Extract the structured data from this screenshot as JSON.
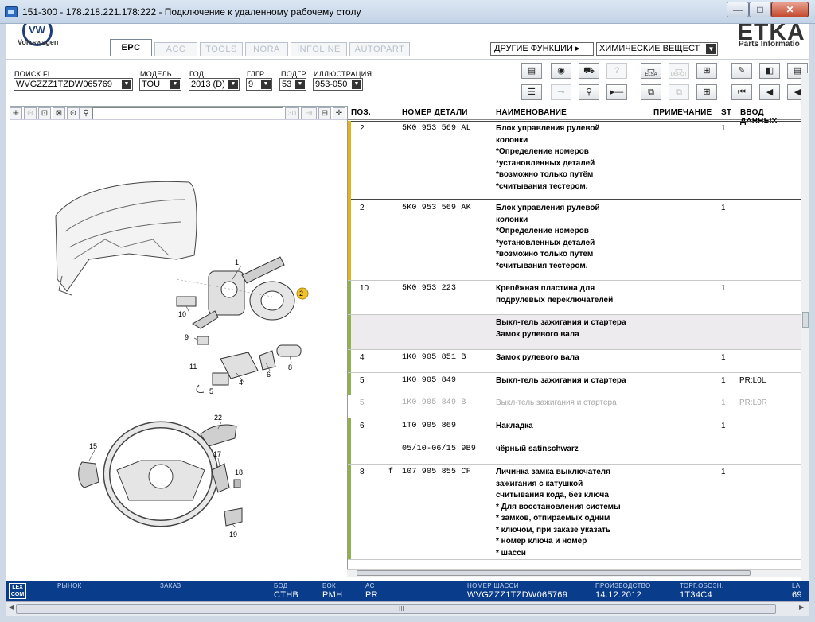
{
  "window": {
    "title": "151-300 - 178.218.221.178:222 - Подключение к удаленному рабочему столу",
    "min_label": "—",
    "max_label": "□",
    "close_label": "✕"
  },
  "brand": {
    "vw_text": "Volkswagen",
    "etka": "ETKA",
    "etka_sub": "Parts Informatio"
  },
  "tabs": [
    {
      "label": "EPC",
      "active": true
    },
    {
      "label": "ACC",
      "active": false
    },
    {
      "label": "TOOLS",
      "active": false
    },
    {
      "label": "NORA",
      "active": false
    },
    {
      "label": "INFOLINE",
      "active": false
    },
    {
      "label": "AUTOPART",
      "active": false
    }
  ],
  "other_functions": {
    "label": "ДРУГИЕ ФУНКЦИИ ▸",
    "selected": "ХИМИЧЕСКИЕ ВЕЩЕСТ"
  },
  "filters": {
    "search_fi": {
      "label": "ПОИСК FI",
      "value": "WVGZZZ1TZDW065769"
    },
    "model": {
      "label": "МОДЕЛЬ",
      "value": "TOU"
    },
    "year": {
      "label": "ГОД",
      "value": "2013 (D)"
    },
    "mg": {
      "label": "ГЛГР",
      "value": "9"
    },
    "sg": {
      "label": "ПОДГР",
      "value": "53"
    },
    "illustration": {
      "label": "ИЛЛЮСТРАЦИЯ",
      "value": "953-050"
    }
  },
  "toolbar_small_labels": {
    "elsa": "ELSA",
    "depot": "DEPOT"
  },
  "table": {
    "headers": {
      "pos": "ПОЗ.",
      "part_no": "НОМЕР ДЕТАЛИ",
      "name": "НАИМЕНОВАНИЕ",
      "note": "ПРИМЕЧАНИЕ",
      "st": "ST",
      "input": "ВВОД ДАННЫХ"
    },
    "rows": [
      {
        "pos": "2",
        "flag": "",
        "part_no": "5K0 953 569 AL",
        "name": "Блок управления рулевой\nколонки\n*Определение номеров\n*установленных деталей\n*возможно только путём\n*считывания тестером.",
        "st": "1",
        "data": "",
        "state": "selected",
        "bar": "#e3b21f"
      },
      {
        "pos": "2",
        "flag": "",
        "part_no": "5K0 953 569 AK",
        "name": "Блок управления рулевой\nколонки\n*Определение номеров\n*установленных деталей\n*возможно только путём\n*считывания тестером.",
        "st": "1",
        "data": "",
        "state": "normal",
        "bar": "#e3b21f"
      },
      {
        "pos": "10",
        "flag": "",
        "part_no": "5K0 953 223",
        "name": "Крепёжная пластина для\nподрулевых переключателей",
        "st": "1",
        "data": "",
        "state": "normal",
        "bar": "#8fb34a"
      },
      {
        "pos": "",
        "flag": "",
        "part_no": "",
        "name": "Выкл-тель зажигания и стартера\nЗамок рулевого вала",
        "st": "",
        "data": "",
        "state": "header",
        "bar": "#8fb34a"
      },
      {
        "pos": "4",
        "flag": "",
        "part_no": "1K0 905 851 B",
        "name": "Замок рулевого вала",
        "st": "1",
        "data": "",
        "state": "normal",
        "bar": "#8fb34a"
      },
      {
        "pos": "5",
        "flag": "",
        "part_no": "1K0 905 849",
        "name": "Выкл-тель зажигания и стартера",
        "st": "1",
        "data": "PR:L0L",
        "state": "normal",
        "bar": "#8fb34a"
      },
      {
        "pos": "5",
        "flag": "",
        "part_no": "1K0 905 849 B",
        "name": "Выкл-тель зажигания и стартера",
        "st": "1",
        "data": "PR:L0R",
        "state": "grey",
        "bar": "#ffffff"
      },
      {
        "pos": "6",
        "flag": "",
        "part_no": "1T0 905 869",
        "name": "Накладка",
        "st": "1",
        "data": "",
        "state": "normal",
        "bar": "#8fb34a"
      },
      {
        "pos": "",
        "flag": "",
        "part_no": "05/10-06/15 9B9",
        "name": "чёрный satinschwarz",
        "st": "",
        "data": "",
        "state": "normal",
        "bar": "#8fb34a"
      },
      {
        "pos": "8",
        "flag": "f",
        "part_no": "107 905 855 CF",
        "name": "Личинка замка выключателя\nзажигания с катушкой\nсчитывания кода, без ключа\n* Для восстановления системы\n* замков, отпираемых одним\n* ключом, при заказе указать\n* номер ключа и номер\n* шасси",
        "st": "1",
        "data": "",
        "state": "normal",
        "bar": "#8fb34a"
      }
    ]
  },
  "illustration_callouts": [
    "1",
    "2",
    "10",
    "9",
    "11",
    "5",
    "4",
    "6",
    "8",
    "22",
    "15",
    "17",
    "18",
    "19"
  ],
  "status": {
    "lexcom": "LEX\nCOM",
    "market": {
      "label": "РЫНОК",
      "value": ""
    },
    "order": {
      "label": "ЗАКАЗ",
      "value": ""
    },
    "bod": {
      "label": "БОД",
      "value": "CTHB"
    },
    "bok": {
      "label": "БОК",
      "value": "PMH"
    },
    "ac": {
      "label": "AC",
      "value": "PR"
    },
    "vin": {
      "label": "НОМЕР ШАССИ",
      "value": "WVGZZZ1TZDW065769"
    },
    "production": {
      "label": "ПРОИЗВОДСТВО",
      "value": "14.12.2012"
    },
    "trade": {
      "label": "ТОРГ.ОБОЗН.",
      "value": "1T34C4"
    },
    "la": {
      "label": "LA",
      "value": "69"
    }
  },
  "scroll": {
    "grip": "III"
  }
}
